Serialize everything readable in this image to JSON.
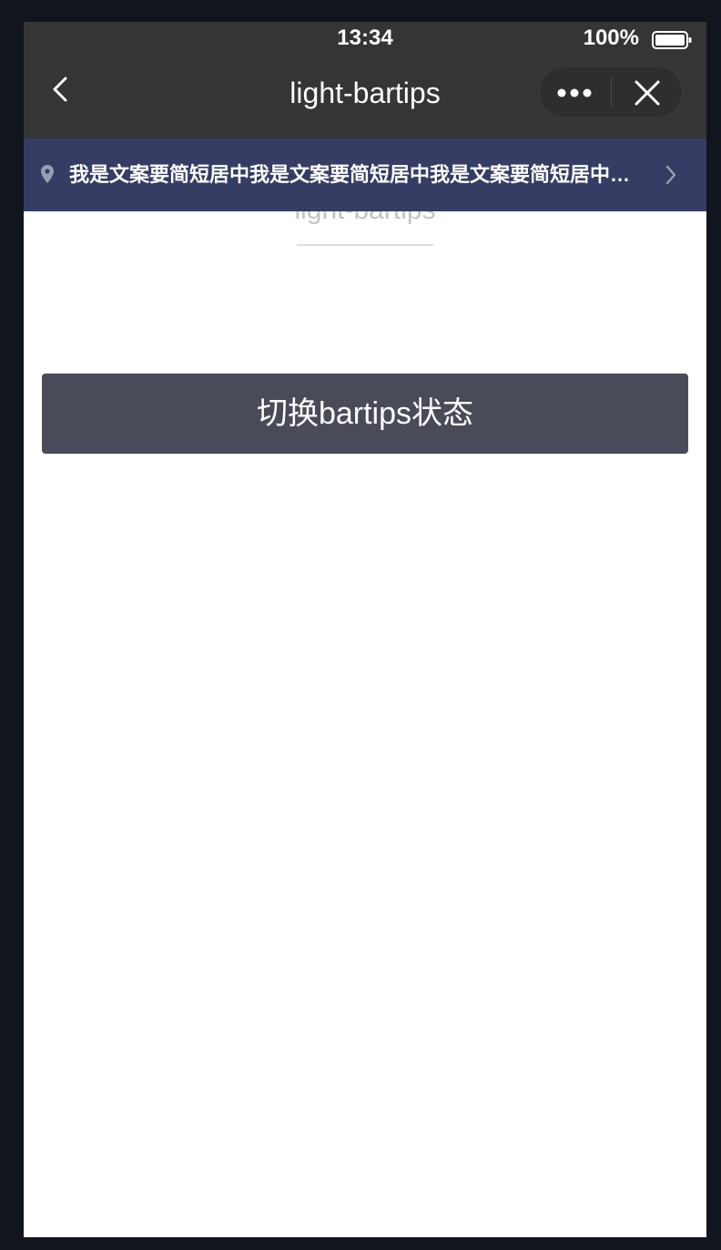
{
  "status_bar": {
    "time": "13:34",
    "battery": "100%"
  },
  "nav_bar": {
    "title": "light-bartips",
    "icons": {
      "back": "chevron-left-icon",
      "more": "more-dots-icon",
      "close": "close-icon"
    }
  },
  "bartips": {
    "text": "我是文案要简短居中我是文案要简短居中我是文案要简短居中我是文案要简短居中",
    "icons": {
      "leading": "location-pin-icon",
      "trailing": "chevron-right-icon"
    },
    "background_color": "#353d64"
  },
  "main": {
    "heading": "light-bartips",
    "toggle_button_label": "切换bartips状态"
  },
  "colors": {
    "nav_background": "#353535",
    "button_background": "#4a4b59",
    "page_background": "#ffffff"
  }
}
